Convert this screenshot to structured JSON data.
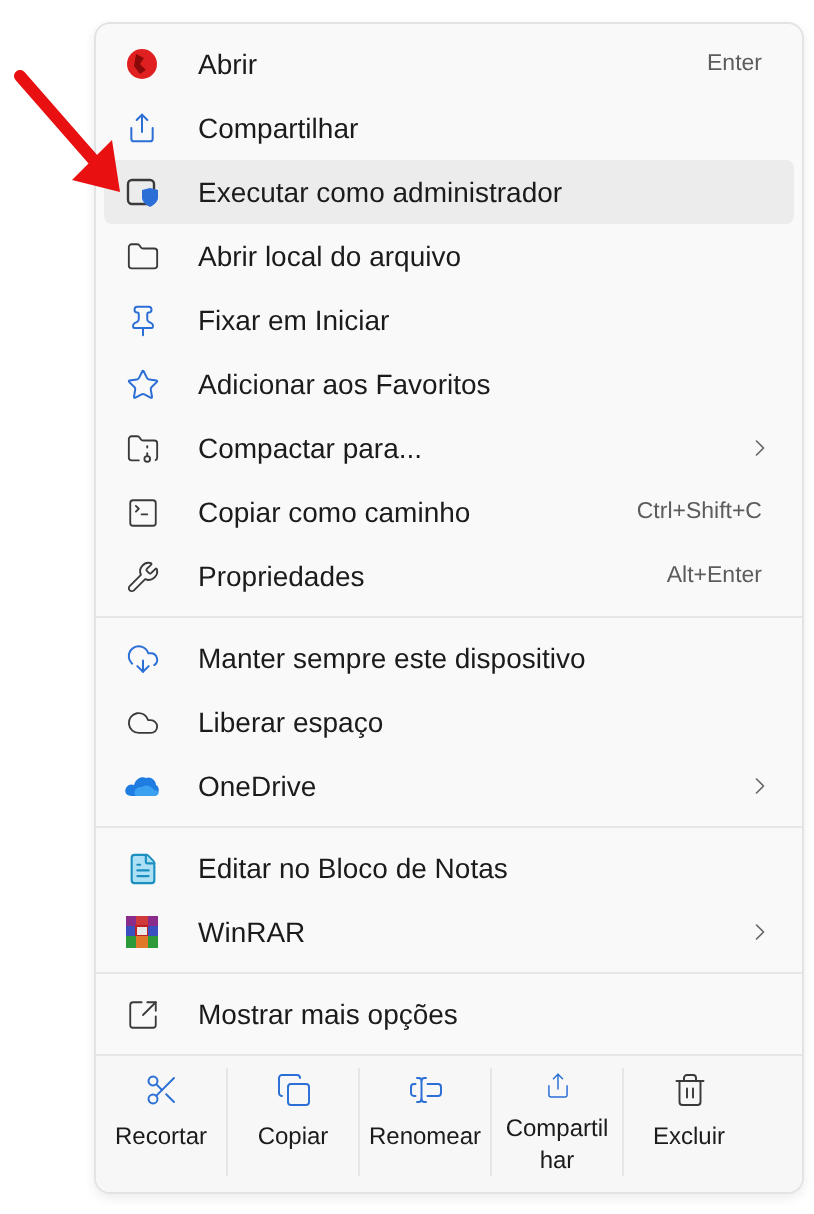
{
  "groups": [
    {
      "items": [
        {
          "label": "Abrir",
          "shortcut": "Enter",
          "submenu": false,
          "selected": false
        },
        {
          "label": "Compartilhar",
          "submenu": false,
          "selected": false
        },
        {
          "label": "Executar como administrador",
          "submenu": false,
          "selected": true
        },
        {
          "label": "Abrir local do arquivo",
          "submenu": false,
          "selected": false
        },
        {
          "label": "Fixar em Iniciar",
          "submenu": false,
          "selected": false
        },
        {
          "label": "Adicionar aos Favoritos",
          "submenu": false,
          "selected": false
        },
        {
          "label": "Compactar para...",
          "submenu": true,
          "selected": false
        },
        {
          "label": "Copiar como caminho",
          "shortcut": "Ctrl+Shift+C",
          "submenu": false,
          "selected": false
        },
        {
          "label": "Propriedades",
          "shortcut": "Alt+Enter",
          "submenu": false,
          "selected": false
        }
      ]
    },
    {
      "items": [
        {
          "label": "Manter sempre este dispositivo",
          "submenu": false,
          "selected": false
        },
        {
          "label": "Liberar espaço",
          "submenu": false,
          "selected": false
        },
        {
          "label": "OneDrive",
          "submenu": true,
          "selected": false
        }
      ]
    },
    {
      "items": [
        {
          "label": "Editar no Bloco de Notas",
          "submenu": false,
          "selected": false
        },
        {
          "label": "WinRAR",
          "submenu": true,
          "selected": false
        }
      ]
    },
    {
      "items": [
        {
          "label": "Mostrar mais opções",
          "submenu": false,
          "selected": false
        }
      ]
    }
  ],
  "actions": [
    {
      "label": "Recortar"
    },
    {
      "label": "Copiar"
    },
    {
      "label": "Renomear"
    },
    {
      "label": "Compartilhar"
    },
    {
      "label": "Excluir"
    }
  ]
}
